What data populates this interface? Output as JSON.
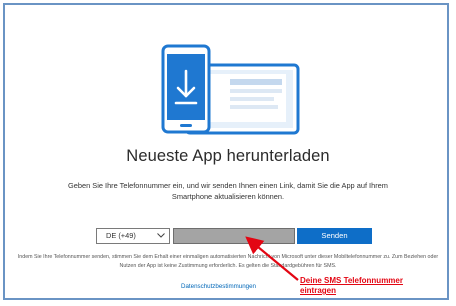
{
  "main": {
    "title": "Neueste App herunterladen",
    "description": "Geben Sie Ihre Telefonnummer ein, und wir senden Ihnen einen Link, damit Sie die App auf Ihrem Smartphone aktualisieren können.",
    "country_select": {
      "selected": "DE (+49)"
    },
    "phone_input": {
      "value": ""
    },
    "send_label": "Senden",
    "legal_text": "Indem Sie Ihre Telefonnummer senden, stimmen Sie dem Erhalt einer einmaligen automatisierten Nachricht von Microsoft unter dieser Mobiltelefonnummer zu. Zum Beziehen oder Nutzen der App ist keine Zustimmung erforderlich. Es gelten die Standardgebühren für SMS.",
    "privacy_link": "Datenschutzbestimmungen"
  },
  "annotation": {
    "line1": "Deine SMS Telefonnummer",
    "line2": "eintragen",
    "color": "#e30613"
  },
  "colors": {
    "accent": "#0e6ec8",
    "frame_border": "#6a94c4",
    "illustration_blue": "#1f78d1"
  },
  "icons": [
    "download-arrow-icon",
    "chevron-down-icon"
  ]
}
